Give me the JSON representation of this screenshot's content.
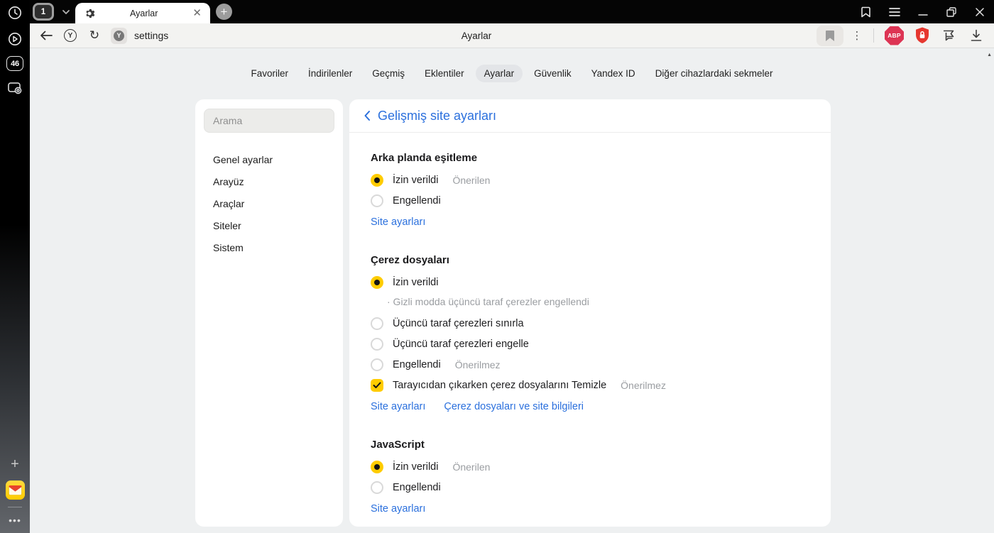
{
  "chrome": {
    "tab_counter": "1",
    "tab_title": "Ayarlar",
    "page_title": "Ayarlar",
    "address_value": "settings",
    "abp_label": "ABP",
    "favicon_letter": "Y",
    "yandex_letter": "Y"
  },
  "rail": {
    "tab_count": "46"
  },
  "nav_tabs": {
    "active": "Ayarlar",
    "items": [
      "Favoriler",
      "İndirilenler",
      "Geçmiş",
      "Eklentiler",
      "Ayarlar",
      "Güvenlik",
      "Yandex ID",
      "Diğer cihazlardaki sekmeler"
    ]
  },
  "settings_nav": {
    "search_placeholder": "Arama",
    "items": [
      "Genel ayarlar",
      "Arayüz",
      "Araçlar",
      "Siteler",
      "Sistem"
    ]
  },
  "panel": {
    "back_title": "Gelişmiş site ayarları",
    "sections": [
      {
        "title": "Arka planda eşitleme",
        "options": [
          {
            "type": "radio",
            "checked": true,
            "label": "İzin verildi",
            "badge": "Önerilen"
          },
          {
            "type": "radio",
            "checked": false,
            "label": "Engellendi"
          }
        ],
        "links": [
          "Site ayarları"
        ]
      },
      {
        "title": "Çerez dosyaları",
        "options": [
          {
            "type": "radio",
            "checked": true,
            "label": "İzin verildi"
          },
          {
            "type": "note",
            "label": "· Gizli modda üçüncü taraf çerezler engellendi"
          },
          {
            "type": "radio",
            "checked": false,
            "label": "Üçüncü taraf çerezleri sınırla"
          },
          {
            "type": "radio",
            "checked": false,
            "label": "Üçüncü taraf çerezleri engelle"
          },
          {
            "type": "radio",
            "checked": false,
            "label": "Engellendi",
            "badge": "Önerilmez"
          },
          {
            "type": "checkbox",
            "checked": true,
            "label": "Tarayıcıdan çıkarken çerez dosyalarını Temizle",
            "badge": "Önerilmez"
          }
        ],
        "links": [
          "Site ayarları",
          "Çerez dosyaları ve site bilgileri"
        ]
      },
      {
        "title": "JavaScript",
        "options": [
          {
            "type": "radio",
            "checked": true,
            "label": "İzin verildi",
            "badge": "Önerilen"
          },
          {
            "type": "radio",
            "checked": false,
            "label": "Engellendi"
          }
        ],
        "links": [
          "Site ayarları"
        ]
      }
    ]
  }
}
